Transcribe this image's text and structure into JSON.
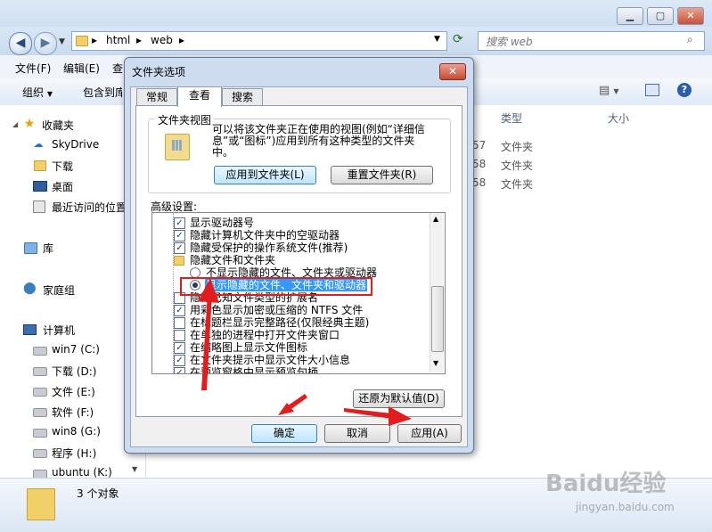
{
  "explorer": {
    "breadcrumb": [
      "html",
      "web"
    ],
    "search_placeholder": "搜索 web",
    "menu": [
      "文件(F)",
      "编辑(E)",
      "查"
    ],
    "toolbar": {
      "organize": "组织",
      "include": "包含到库"
    },
    "columns": {
      "type": "类型",
      "size": "大小"
    },
    "files": [
      {
        "date_fragment": "57",
        "type": "文件夹"
      },
      {
        "date_fragment": "58",
        "type": "文件夹"
      },
      {
        "date_fragment": "58",
        "type": "文件夹"
      }
    ],
    "nav": {
      "favorites": "收藏夹",
      "skydrive": "SkyDrive",
      "downloads": "下载",
      "desktop": "桌面",
      "recent": "最近访问的位置",
      "libraries": "库",
      "homegroup": "家庭组",
      "computer": "计算机",
      "drives": [
        "win7 (C:)",
        "下载 (D:)",
        "文件 (E:)",
        "软件 (F:)",
        "win8 (G:)",
        "程序 (H:)",
        "ubuntu (K:)"
      ]
    },
    "status": "3 个对象",
    "window_buttons": {
      "minimize": "▁",
      "maximize": "▢",
      "close": "✕"
    }
  },
  "dialog": {
    "title": "文件夹选项",
    "close": "✕",
    "tabs": [
      "常规",
      "查看",
      "搜索"
    ],
    "folder_views": {
      "heading": "文件夹视图",
      "description_line1": "可以将该文件夹正在使用的视图(例如“详细信",
      "description_line2": "息”或“图标”)应用到所有这种类型的文件夹",
      "description_line3": "中。",
      "apply_button": "应用到文件夹(L)",
      "reset_button": "重置文件夹(R)"
    },
    "advanced_heading": "高级设置:",
    "settings": [
      {
        "kind": "checkbox",
        "checked": true,
        "label": "显示驱动器号"
      },
      {
        "kind": "checkbox",
        "checked": true,
        "label": "隐藏计算机文件夹中的空驱动器"
      },
      {
        "kind": "checkbox",
        "checked": true,
        "label": "隐藏受保护的操作系统文件(推荐)"
      },
      {
        "kind": "folder",
        "label": "隐藏文件和文件夹"
      },
      {
        "kind": "radio",
        "checked": false,
        "label": "不显示隐藏的文件、文件夹或驱动器"
      },
      {
        "kind": "radio",
        "checked": true,
        "label": "显示隐藏的文件、文件夹和驱动器"
      },
      {
        "kind": "checkbox",
        "checked": false,
        "label": "隐藏已知文件类型的扩展名"
      },
      {
        "kind": "checkbox",
        "checked": true,
        "label": "用彩色显示加密或压缩的 NTFS 文件"
      },
      {
        "kind": "checkbox",
        "checked": false,
        "label": "在标题栏显示完整路径(仅限经典主题)"
      },
      {
        "kind": "checkbox",
        "checked": false,
        "label": "在单独的进程中打开文件夹窗口"
      },
      {
        "kind": "checkbox",
        "checked": true,
        "label": "在缩略图上显示文件图标"
      },
      {
        "kind": "checkbox",
        "checked": true,
        "label": "在文件夹提示中显示文件大小信息"
      },
      {
        "kind": "checkbox",
        "checked": true,
        "label": "在预览窗格中显示预览句柄"
      }
    ],
    "restore_button": "还原为默认值(D)",
    "ok_button": "确定",
    "cancel_button": "取消",
    "apply_button": "应用(A)"
  },
  "watermark": {
    "brand": "Baidu经验",
    "url": "jingyan.baidu.com"
  },
  "colors": {
    "annotation": "#e21d1d",
    "selection": "#3399ff"
  }
}
